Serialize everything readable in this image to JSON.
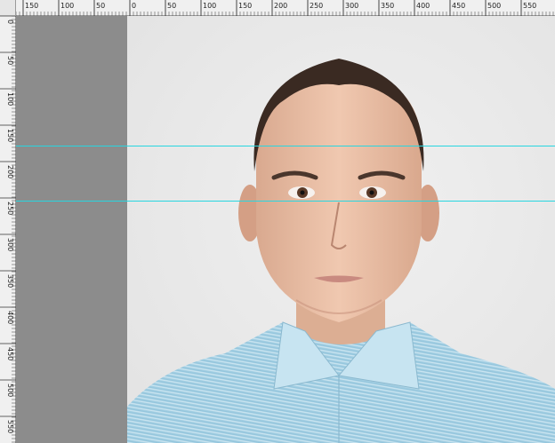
{
  "rulers": {
    "top_labels": [
      "150",
      "100",
      "50",
      "0",
      "50",
      "100",
      "150",
      "200",
      "250",
      "300",
      "350",
      "400",
      "450",
      "500",
      "550"
    ],
    "left_labels": [
      "0",
      "50",
      "100",
      "150",
      "200",
      "250",
      "300",
      "350",
      "400",
      "450",
      "500",
      "550"
    ]
  },
  "photo": {
    "subject": "man-portrait"
  },
  "colors": {
    "guide": "#27d6e0",
    "pasteboard": "#8c8c8c",
    "background": "#e9e9e9",
    "shirt": "#a9d3e6"
  }
}
